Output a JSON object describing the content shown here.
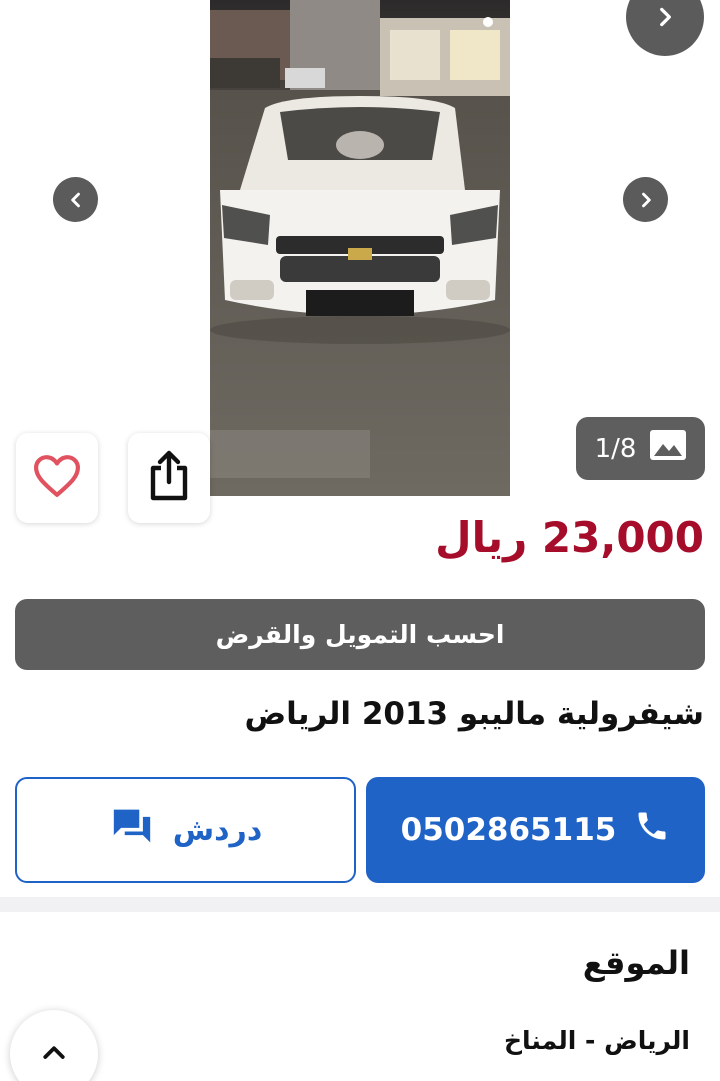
{
  "gallery": {
    "counter": "1/8",
    "icons": {
      "prev": "chevron-left-icon",
      "next": "chevron-right-icon",
      "counter": "image-icon",
      "favorite": "heart-icon",
      "share": "share-icon"
    }
  },
  "listing": {
    "price": "23,000 ريال",
    "title": "شيفرولية ماليبو 2013 الرياض"
  },
  "finance": {
    "label": "احسب التمويل والقرض"
  },
  "contact": {
    "phone": "0502865115",
    "chat_label": "دردش",
    "icons": {
      "phone": "phone-icon",
      "chat": "chat-icon"
    }
  },
  "location": {
    "heading": "الموقع",
    "value": "الرياض - المناخ"
  },
  "colors": {
    "price": "#a50d2b",
    "primary": "#1f63c6",
    "dark_button": "#5e5e5e",
    "favorite": "#e0525f"
  }
}
